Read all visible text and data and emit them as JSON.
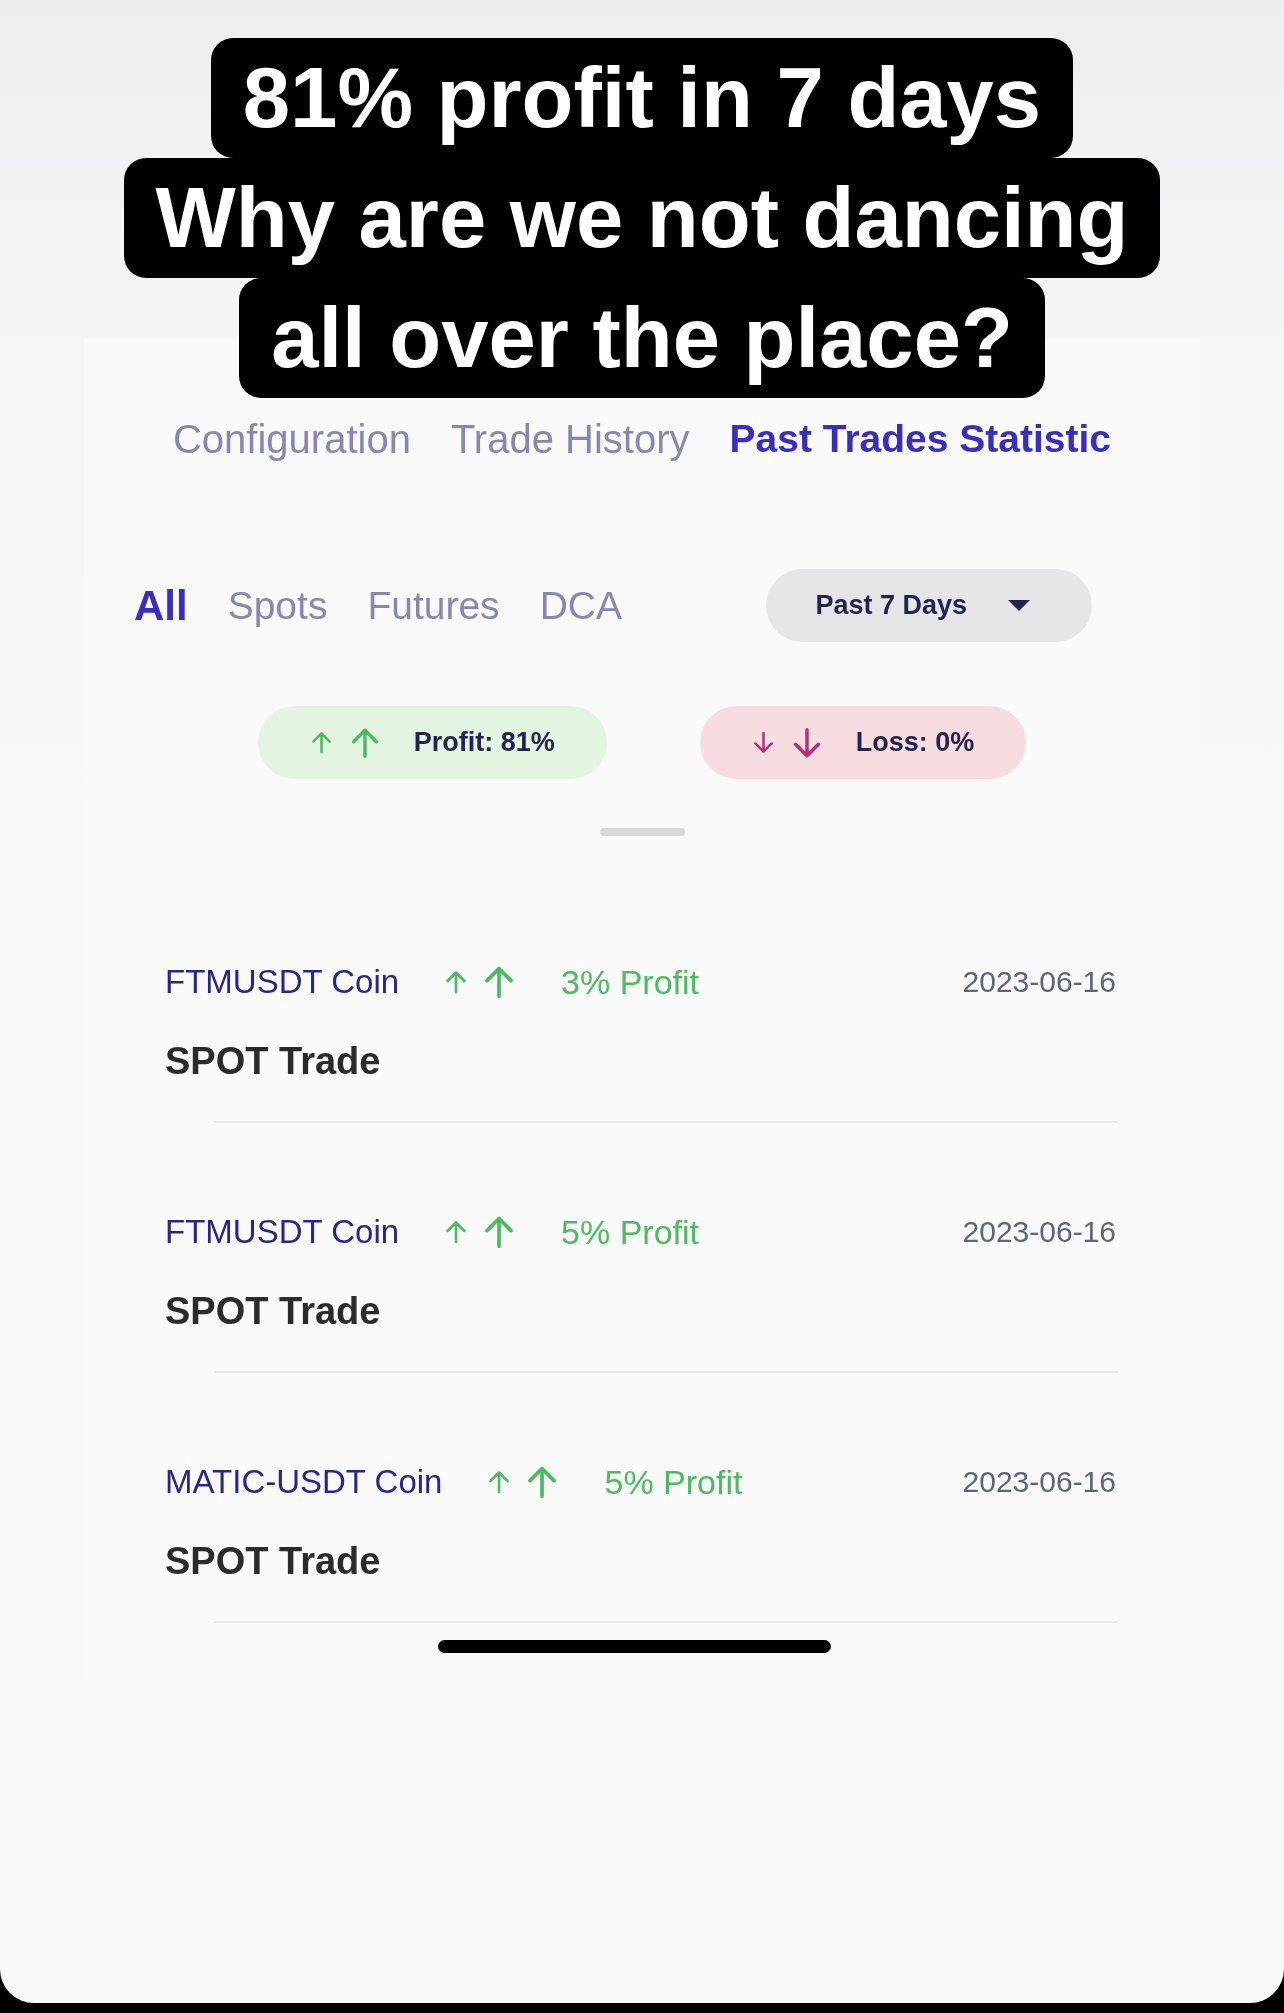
{
  "caption": {
    "lines": [
      "81% profit in 7 days",
      "Why are we not dancing",
      "all over the place?"
    ]
  },
  "tabs": [
    {
      "label": "Configuration",
      "selected": false
    },
    {
      "label": "Trade History",
      "selected": false
    },
    {
      "label": "Past Trades Statistic",
      "selected": true
    }
  ],
  "filters": [
    {
      "label": "All",
      "selected": true
    },
    {
      "label": "Spots",
      "selected": false
    },
    {
      "label": "Futures",
      "selected": false
    },
    {
      "label": "DCA",
      "selected": false
    }
  ],
  "period_dropdown": {
    "value": "Past 7 Days"
  },
  "summary": [
    {
      "kind": "profit",
      "label": "Profit: 81%"
    },
    {
      "kind": "loss",
      "label": "Loss: 0%"
    }
  ],
  "trades": [
    {
      "coin": "FTMUSDT Coin",
      "kind": "profit",
      "result": "3% Profit",
      "date": "2023-06-16",
      "type": "SPOT Trade"
    },
    {
      "coin": "FTMUSDT Coin",
      "kind": "profit",
      "result": "5% Profit",
      "date": "2023-06-16",
      "type": "SPOT Trade"
    },
    {
      "coin": "MATIC-USDT Coin",
      "kind": "profit",
      "result": "5% Profit",
      "date": "2023-06-16",
      "type": "SPOT Trade"
    }
  ]
}
